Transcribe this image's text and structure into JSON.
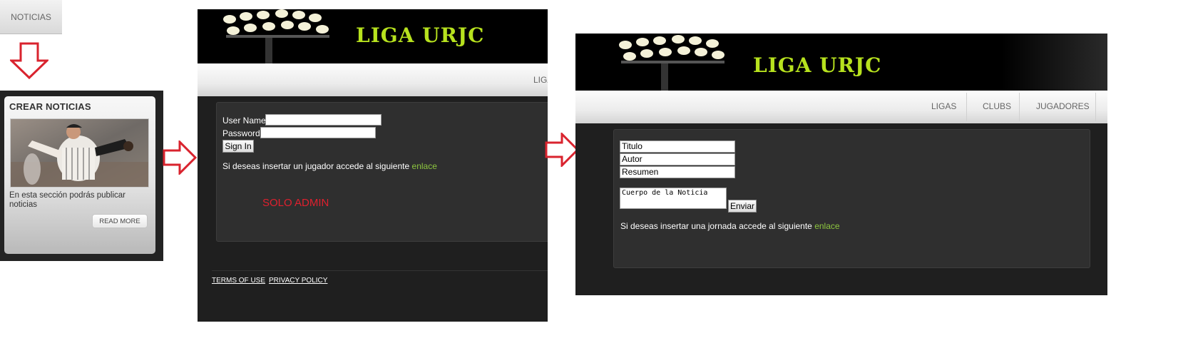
{
  "step1": {
    "tab_label": "NOTICIAS",
    "card": {
      "title": "CREAR NOTICIAS",
      "description": "En esta sección podrás publicar noticias",
      "read_more": "READ MORE"
    }
  },
  "step2": {
    "brand": "LIGA URJC",
    "nav_partial": "LIGA",
    "login": {
      "username_label": "User Name:",
      "password_label": "Password:",
      "username_value": "",
      "password_value": "",
      "sign_in": "Sign In"
    },
    "note_text": "Si deseas insertar un jugador accede al siguiente",
    "note_link": "enlace",
    "admin_only": "SOLO ADMIN",
    "footer": {
      "terms": "TERMS OF USE",
      "privacy": "PRIVACY POLICY"
    }
  },
  "step3": {
    "brand": "LIGA URJC",
    "nav": [
      "LIGAS",
      "CLUBS",
      "JUGADORES"
    ],
    "form": {
      "titulo": "Titulo",
      "autor": "Autor",
      "resumen": "Resumen",
      "cuerpo": "Cuerpo de la Noticia",
      "submit": "Enviar"
    },
    "note_text": "Si deseas insertar una jornada accede al siguiente",
    "note_link": "enlace"
  },
  "colors": {
    "brand_green": "#b7e21e",
    "link_green": "#8dc63f",
    "arrow_red": "#d9232e",
    "admin_red": "#e0202e",
    "panel_dark": "#1f1f1f",
    "box_dark": "#2f2f2f"
  },
  "icons": [
    "arrow-down-icon",
    "arrow-right-icon",
    "stadium-lights-icon"
  ]
}
